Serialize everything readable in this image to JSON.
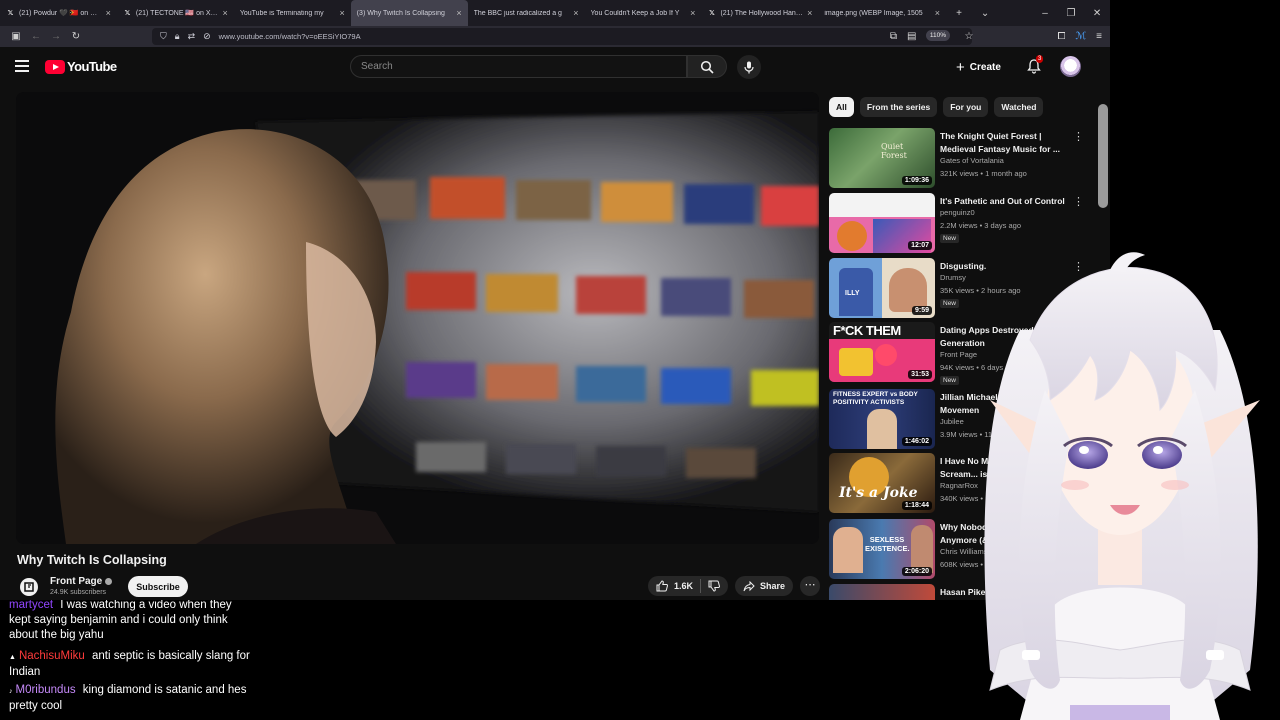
{
  "browser": {
    "tabs": [
      {
        "favicon": "x-icon",
        "label": "(21) Powdur 🖤 🇹🇱 on X: \"@"
      },
      {
        "favicon": "x-icon",
        "label": "(21) TECTONE 🇺🇸 on X: \"I am"
      },
      {
        "favicon": "youtube-icon",
        "label": "YouTube is Terminating my"
      },
      {
        "favicon": "youtube-icon",
        "label": "(3) Why Twitch Is Collapsing"
      },
      {
        "favicon": "youtube-icon",
        "label": "The BBC just radicalized a g"
      },
      {
        "favicon": "youtube-icon",
        "label": "You Couldn't Keep a Job If Y"
      },
      {
        "favicon": "x-icon",
        "label": "(21) The Hollywood Handle"
      },
      {
        "favicon": "image-icon",
        "label": "image.png (WEBP Image, 1505"
      }
    ],
    "url": "www.youtube.com/watch?v=oEESiYIO79A",
    "zoom": "110%"
  },
  "youtube": {
    "logo_text": "YouTube",
    "search_placeholder": "Search",
    "create_label": "Create",
    "notification_count": "3",
    "video": {
      "title": "Why Twitch Is Collapsing",
      "channel": "Front Page",
      "subscribers": "24.9K subscribers",
      "subscribe_label": "Subscribe",
      "likes": "1.6K",
      "share_label": "Share"
    },
    "chips": [
      "All",
      "From the series",
      "For you",
      "Watched"
    ],
    "recommendations": [
      {
        "title": "The Knight Quiet Forest | Medieval Fantasy Music for ...",
        "channel": "Gates of Vortalania",
        "meta": "321K views • 1 month ago",
        "duration": "1:09:36",
        "new": "",
        "thumb_text": "Quiet Forest"
      },
      {
        "title": "It's Pathetic and Out of Control",
        "channel": "penguinz0",
        "meta": "2.2M views • 3 days ago",
        "duration": "12:07",
        "new": "New",
        "thumb_text": ""
      },
      {
        "title": "Disgusting.",
        "channel": "Drumsy",
        "meta": "35K views • 2 hours ago",
        "duration": "9:59",
        "new": "New",
        "thumb_text": "ILLY"
      },
      {
        "title": "Dating Apps Destroyed A Generation",
        "channel": "Front Page",
        "meta": "94K views • 6 days ago",
        "duration": "31:53",
        "new": "New",
        "thumb_text": "F*CK THEM"
      },
      {
        "title": "Jillian Michaels vs T Positivity Movemen",
        "channel": "Jubilee",
        "meta": "3.9M views • 11 day",
        "duration": "1:46:02",
        "new": "",
        "thumb_text": "FITNESS EXPERT vs BODY POSITIVITY ACTIVISTS"
      },
      {
        "title": "I Have No Mouth and I Scream... is a Joke.",
        "channel": "RagnarRox",
        "meta": "340K views • 1 month ago",
        "duration": "1:18:44",
        "new": "",
        "thumb_text": "It's a Joke"
      },
      {
        "title": "Why Nobody is Having Sex Anymore (& why it matters) - [",
        "channel": "Chris Williamson",
        "meta": "608K views • 10 days ago",
        "duration": "2:06:20",
        "new": "",
        "thumb_text": "SEXLESS EXISTENCE."
      },
      {
        "title": "Hasan Piker: Criticism N",
        "channel": "",
        "meta": "",
        "duration": "",
        "new": "",
        "thumb_text": ""
      }
    ]
  },
  "chat": [
    {
      "user": "martycet",
      "text": "I was watching a video when they kept saying benjamin and i could only think about the big yahu",
      "user_color": "#9146ff",
      "badge": ""
    },
    {
      "user": "NachisuMiku",
      "text": "anti septic is basically slang for Indian",
      "user_color": "#ff3b3b",
      "badge": "▲"
    },
    {
      "user": "M0ribundus",
      "text": "king diamond is satanic and hes pretty cool",
      "user_color": "#c58af9",
      "badge": "♪"
    }
  ],
  "colors": {
    "youtube_red": "#ff0033",
    "bg": "#0f0f0f",
    "chip_bg": "#272727"
  }
}
